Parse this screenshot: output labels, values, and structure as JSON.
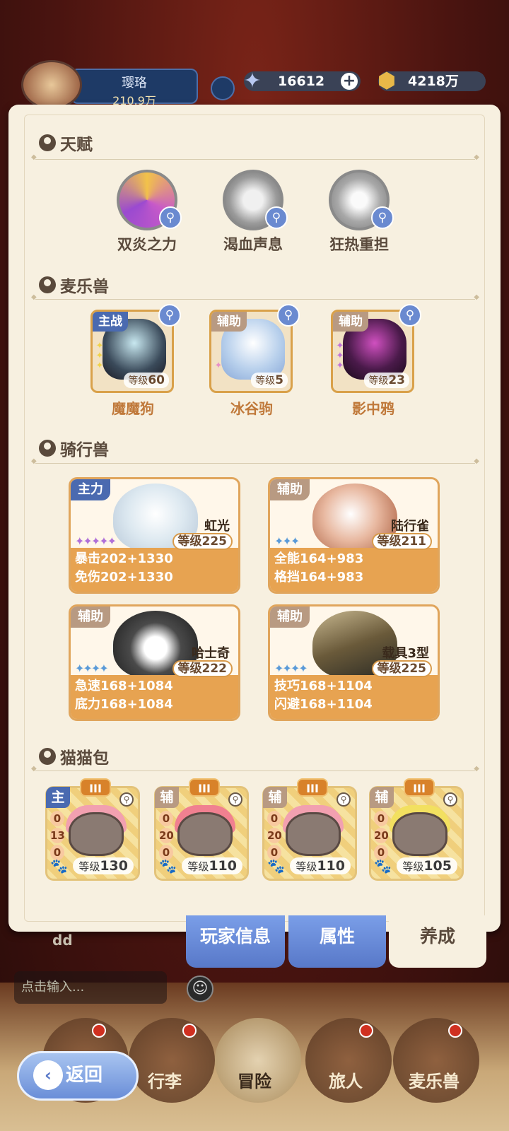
{
  "header": {
    "player_name": "璎珞",
    "power": "210.9万",
    "crystals": "16612",
    "gold": "4218万",
    "plus": "+"
  },
  "sections": {
    "talent": "天赋",
    "pets": "麦乐兽",
    "mounts": "骑行兽",
    "catpacks": "猫猫包"
  },
  "talents": [
    {
      "label": "双炎之力",
      "icon": "dual-flame-icon"
    },
    {
      "label": "渴血声息",
      "icon": "bloodthirst-icon"
    },
    {
      "label": "狂热重担",
      "icon": "fanatic-burden-icon"
    }
  ],
  "pets": [
    {
      "name": "魔魔狗",
      "role": "主战",
      "level_prefix": "等级",
      "level": "60"
    },
    {
      "name": "冰谷驹",
      "role": "辅助",
      "level_prefix": "等级",
      "level": "5"
    },
    {
      "name": "影中鸦",
      "role": "辅助",
      "level_prefix": "等级",
      "level": "23"
    }
  ],
  "mounts": [
    {
      "name": "虹光",
      "role": "主力",
      "level": "等级225",
      "stat1": "暴击202+1330",
      "stat2": "免伤202+1330"
    },
    {
      "name": "陆行雀",
      "role": "辅助",
      "level": "等级211",
      "stat1": "全能164+983",
      "stat2": "格挡164+983"
    },
    {
      "name": "哈士奇",
      "role": "辅助",
      "level": "等级222",
      "stat1": "急速168+1084",
      "stat2": "底力168+1084"
    },
    {
      "name": "载具3型",
      "role": "辅助",
      "level": "等级225",
      "stat1": "技巧168+1104",
      "stat2": "闪避168+1104"
    }
  ],
  "cats": [
    {
      "role": "主",
      "rank": "III",
      "n1": "0",
      "n2": "13",
      "n3": "0",
      "level_prefix": "等级",
      "level": "130"
    },
    {
      "role": "辅",
      "rank": "III",
      "n1": "0",
      "n2": "20",
      "n3": "0",
      "level_prefix": "等级",
      "level": "110"
    },
    {
      "role": "辅",
      "rank": "III",
      "n1": "0",
      "n2": "20",
      "n3": "0",
      "level_prefix": "等级",
      "level": "110"
    },
    {
      "role": "辅",
      "rank": "III",
      "n1": "0",
      "n2": "20",
      "n3": "0",
      "level_prefix": "等级",
      "level": "105"
    }
  ],
  "tabs": {
    "player_info": "玩家信息",
    "attributes": "属性",
    "develop": "养成"
  },
  "chat": {
    "username": "dd",
    "placeholder": "点击输入..."
  },
  "nav": {
    "bag": "行李",
    "adventure": "冒险",
    "traveler": "旅人",
    "pets": "麦乐兽",
    "back": "返回"
  },
  "colors": {
    "accent_blue": "#6a8ad0",
    "orange": "#e7a351",
    "text_brown": "#5a4a3c",
    "main_tag": "#4a6ab0",
    "assist_tag": "#b89a82"
  }
}
